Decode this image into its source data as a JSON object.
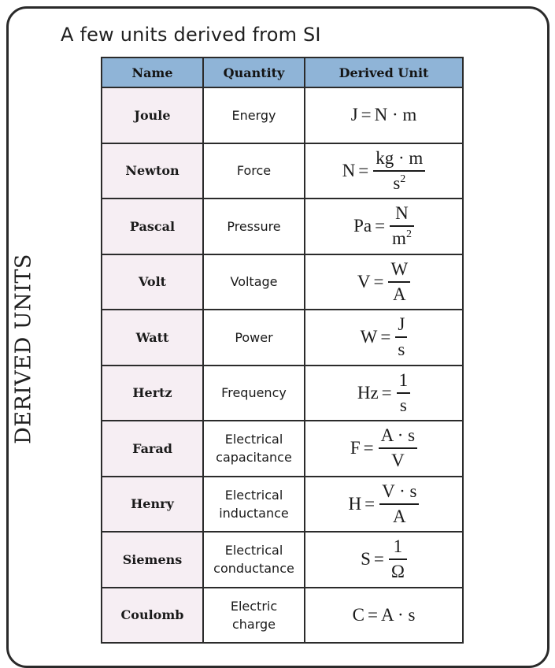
{
  "heading": "A few units derived from SI",
  "side_label": "DERIVED UNITS",
  "headers": {
    "name": "Name",
    "quantity": "Quantity",
    "derived_unit": "Derived Unit"
  },
  "rows": [
    {
      "name": "Joule",
      "quantity_line1": "Energy",
      "quantity_line2": "",
      "lhs": "J",
      "expr": "N · m",
      "num": "",
      "den": "",
      "den_sup": ""
    },
    {
      "name": "Newton",
      "quantity_line1": "Force",
      "quantity_line2": "",
      "lhs": "N",
      "expr": "",
      "num": "kg · m",
      "den": "s",
      "den_sup": "2"
    },
    {
      "name": "Pascal",
      "quantity_line1": "Pressure",
      "quantity_line2": "",
      "lhs": "Pa",
      "expr": "",
      "num": "N",
      "den": "m",
      "den_sup": "2"
    },
    {
      "name": "Volt",
      "quantity_line1": "Voltage",
      "quantity_line2": "",
      "lhs": "V",
      "expr": "",
      "num": "W",
      "den": "A",
      "den_sup": ""
    },
    {
      "name": "Watt",
      "quantity_line1": "Power",
      "quantity_line2": "",
      "lhs": "W",
      "expr": "",
      "num": "J",
      "den": "s",
      "den_sup": ""
    },
    {
      "name": "Hertz",
      "quantity_line1": "Frequency",
      "quantity_line2": "",
      "lhs": "Hz",
      "expr": "",
      "num": "1",
      "den": "s",
      "den_sup": ""
    },
    {
      "name": "Farad",
      "quantity_line1": "Electrical",
      "quantity_line2": "capacitance",
      "lhs": "F",
      "expr": "",
      "num": "A · s",
      "den": "V",
      "den_sup": ""
    },
    {
      "name": "Henry",
      "quantity_line1": "Electrical",
      "quantity_line2": "inductance",
      "lhs": "H",
      "expr": "",
      "num": "V · s",
      "den": "A",
      "den_sup": ""
    },
    {
      "name": "Siemens",
      "quantity_line1": "Electrical",
      "quantity_line2": "conductance",
      "lhs": "S",
      "expr": "",
      "num": "1",
      "den": "Ω",
      "den_sup": ""
    },
    {
      "name": "Coulomb",
      "quantity_line1": "Electric",
      "quantity_line2": "charge",
      "lhs": "C",
      "expr": "A · s",
      "num": "",
      "den": "",
      "den_sup": ""
    }
  ]
}
